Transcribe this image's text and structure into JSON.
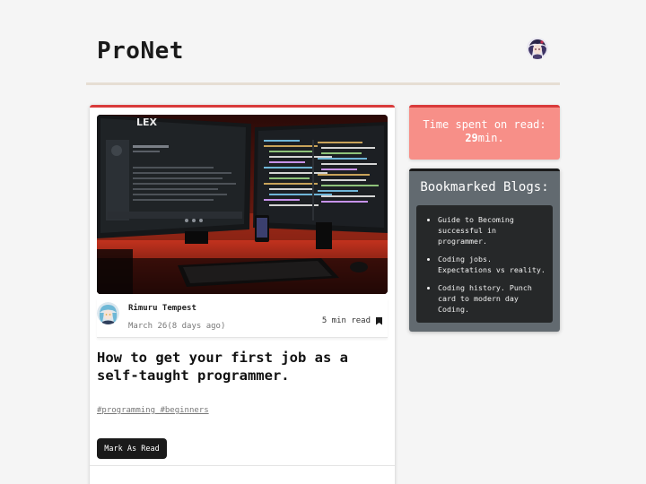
{
  "app": {
    "brand": "ProNet"
  },
  "post": {
    "author": "Rimuru Tempest",
    "date": "March 26(8 days ago)",
    "read_time": "5 min read",
    "title": "How to get your first job as a self-taught programmer.",
    "tags": "#programming #beginners",
    "mark_button_label": "Mark As Read"
  },
  "sidebar": {
    "time_label": "Time spent on read:",
    "time_value": "29",
    "time_unit": "min.",
    "bookmarks_title": "Bookmarked Blogs:",
    "bookmarks": [
      "Guide to Becoming successful in programmer.",
      "Coding jobs. Expectations vs reality.",
      "Coding history. Punch card to modern day Coding."
    ]
  },
  "hero_screen": {
    "logo": "LEX"
  },
  "colors": {
    "accent_red": "#d93b3b",
    "timebox_bg": "#f78f88",
    "bookmarks_bg": "#626a70",
    "bookmarks_list_bg": "#262829",
    "button_bg": "#1a1a1a"
  },
  "icons": {
    "bookmark": "bookmark-icon",
    "avatar": "user-avatar"
  }
}
